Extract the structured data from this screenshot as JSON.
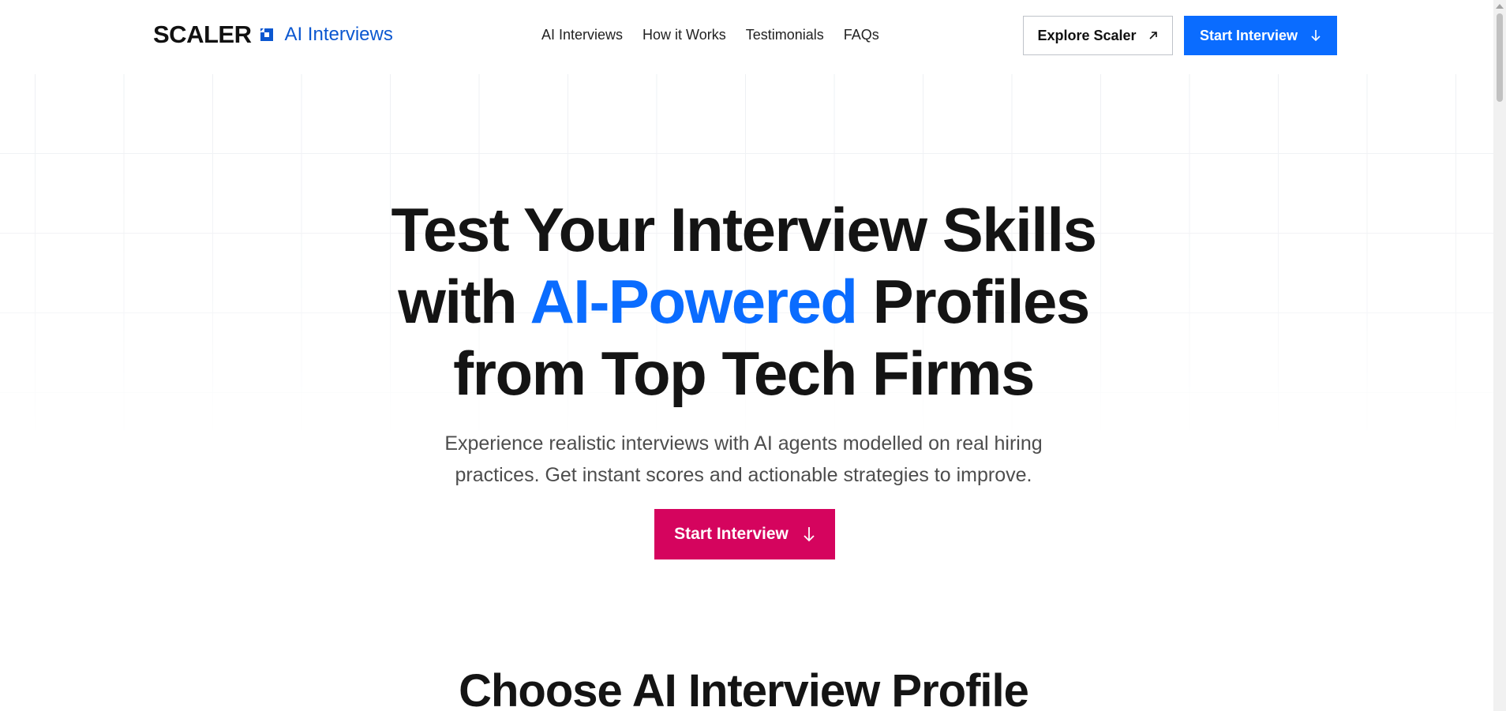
{
  "header": {
    "logo_word": "SCALER",
    "logo_product": "AI Interviews",
    "nav": [
      {
        "label": "AI Interviews"
      },
      {
        "label": "How it Works"
      },
      {
        "label": "Testimonials"
      },
      {
        "label": "FAQs"
      }
    ],
    "explore_label": "Explore Scaler",
    "start_label": "Start Interview"
  },
  "hero": {
    "title_line1": "Test Your Interview Skills",
    "title_line2_pre": "with ",
    "title_line2_accent": "AI-Powered",
    "title_line2_post": " Profiles",
    "title_line3": "from Top Tech Firms",
    "subtitle_line1": "Experience realistic interviews with AI agents modelled on real hiring",
    "subtitle_line2": "practices. Get instant scores and actionable strategies to improve.",
    "cta_label": "Start Interview"
  },
  "section": {
    "title": "Choose AI Interview Profile"
  },
  "icons": {
    "logo_mark": "scaler-logo-mark-icon",
    "explore": "arrow-up-right-icon",
    "start": "arrow-down-icon"
  },
  "colors": {
    "brand_blue": "#0a6cff",
    "logo_blue": "#0b57d0",
    "cta_pink": "#d5045e",
    "text_dark": "#141414",
    "text_muted": "#4d4d4d"
  }
}
